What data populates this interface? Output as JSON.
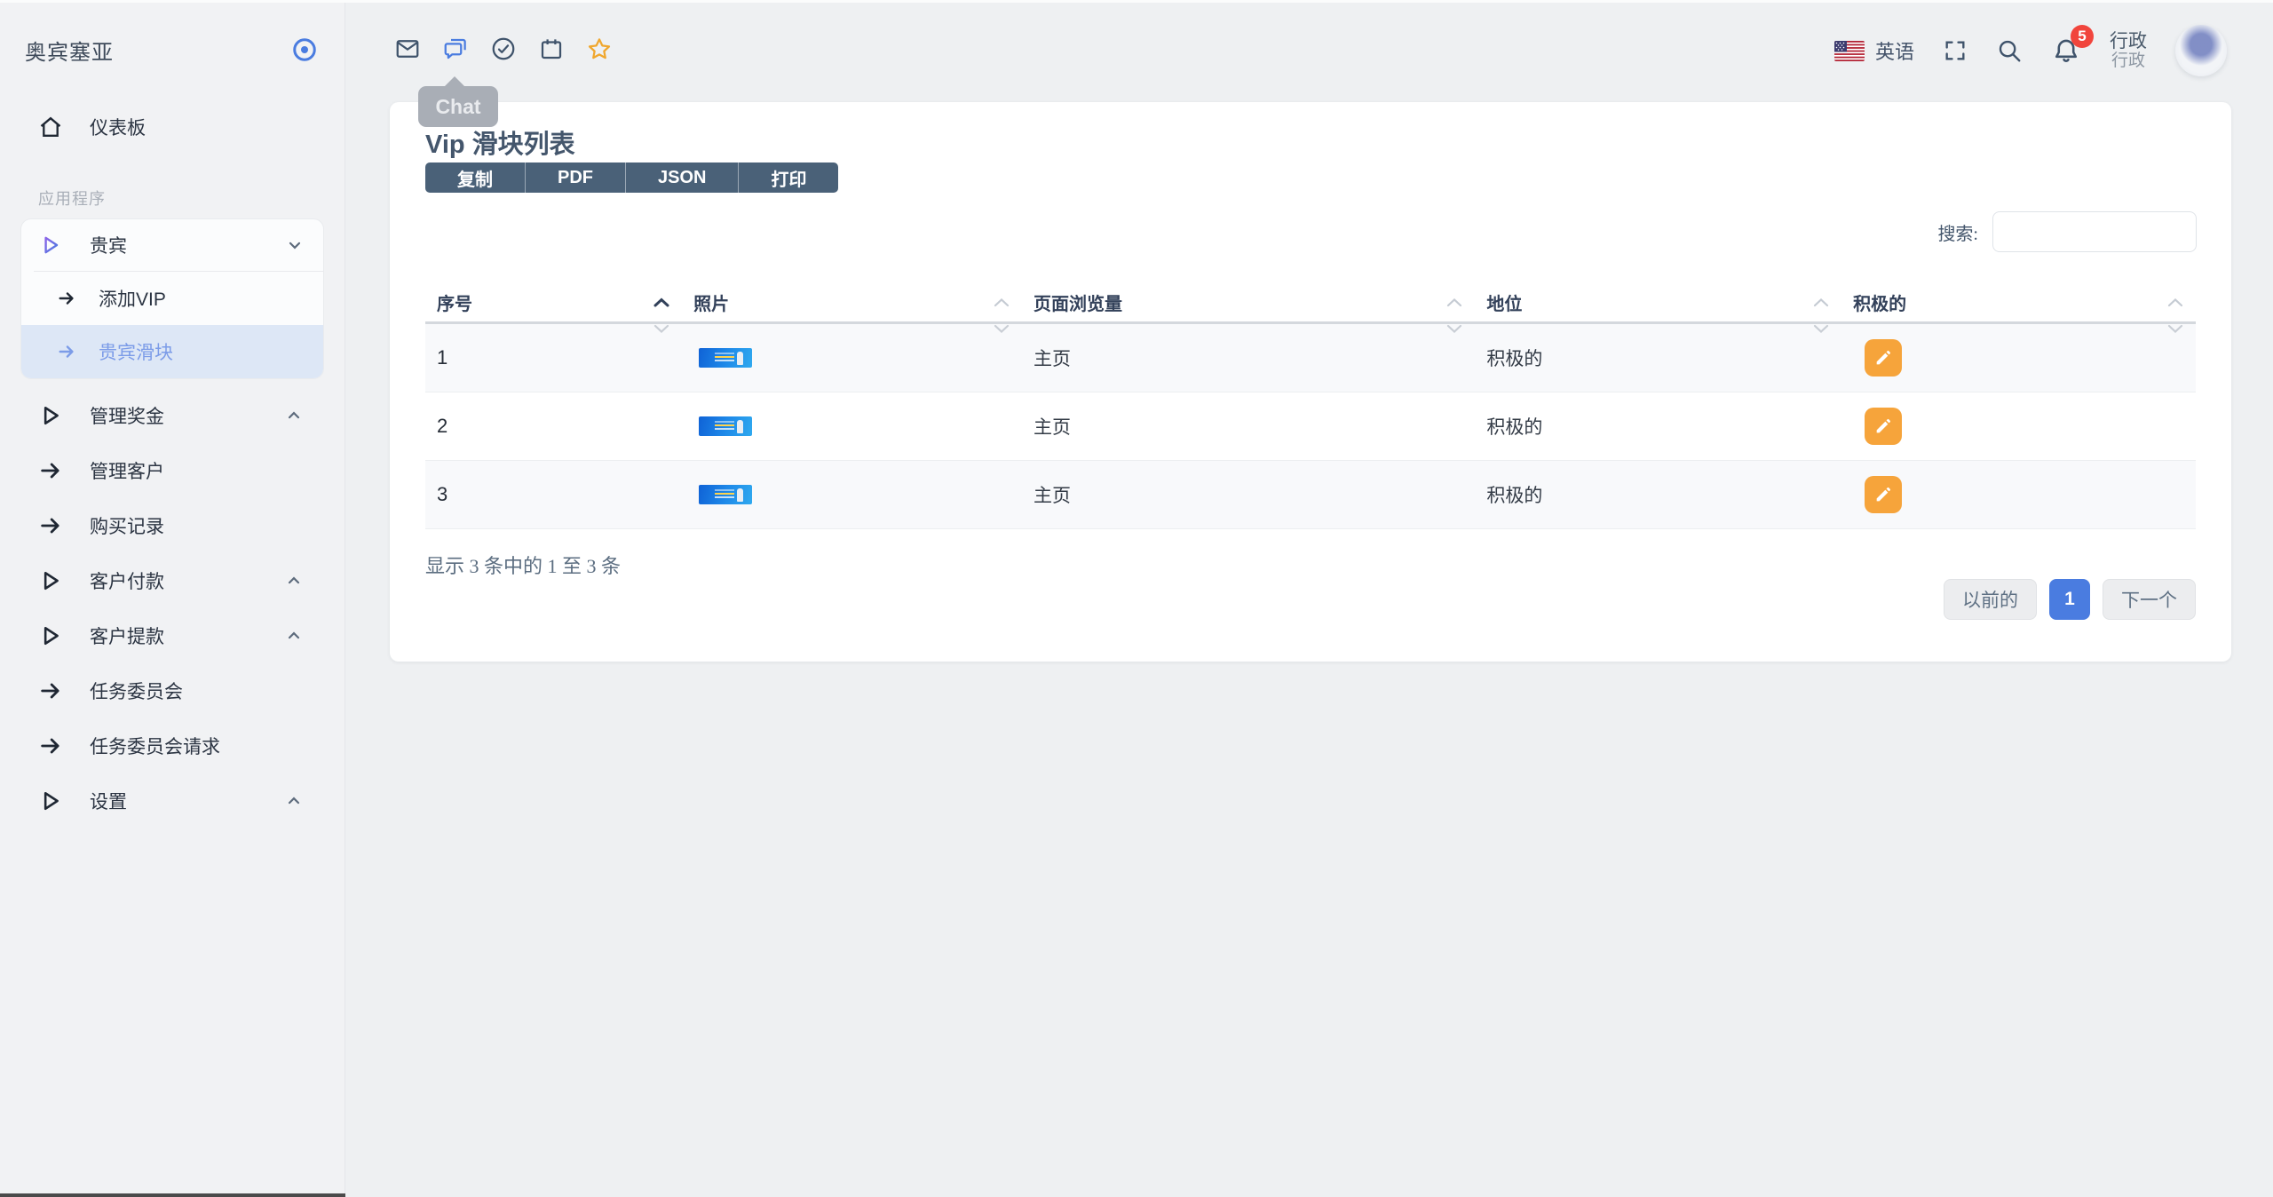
{
  "colors": {
    "accent": "#4a7ce0",
    "orange": "#f6a43b",
    "star_orange": "#f0a72e",
    "danger": "#f1453d",
    "slate": "#44566c",
    "navy": "#3f536b",
    "btn_dark": "#4a6178",
    "active_bg": "#dde7f6",
    "active_text": "#7c9ce8",
    "page_bg": "#eef0f2",
    "sidebar_bg": "#f1f2f4",
    "border": "#e4e6ea"
  },
  "brand": {
    "name": "奥宾塞亚",
    "toggle_icon": "target-icon"
  },
  "sidebar": {
    "dashboard_label": "仪表板",
    "section_label": "应用程序",
    "vip_group": {
      "label": "贵宾",
      "children": [
        {
          "label": "添加VIP",
          "active": false
        },
        {
          "label": "贵宾滑块",
          "active": true
        }
      ]
    },
    "items": [
      {
        "label": "管理奖金",
        "icon": "play",
        "chevron": "up"
      },
      {
        "label": "管理客户",
        "icon": "arrow-right",
        "chevron": null
      },
      {
        "label": "购买记录",
        "icon": "arrow-right",
        "chevron": null
      },
      {
        "label": "客户付款",
        "icon": "play",
        "chevron": "up"
      },
      {
        "label": "客户提款",
        "icon": "play",
        "chevron": "up"
      },
      {
        "label": "任务委员会",
        "icon": "arrow-right",
        "chevron": null
      },
      {
        "label": "任务委员会请求",
        "icon": "arrow-right",
        "chevron": null
      },
      {
        "label": "设置",
        "icon": "play",
        "chevron": "up"
      }
    ]
  },
  "topbar": {
    "left_icons": [
      "mail-icon",
      "chat-icon",
      "check-circle-icon",
      "calendar-icon",
      "star-icon"
    ],
    "tooltip": "Chat",
    "language": "英语",
    "notification_count": "5",
    "user": {
      "name": "行政",
      "role": "行政"
    }
  },
  "page": {
    "title": "Vip 滑块列表",
    "export_buttons": [
      "复制",
      "PDF",
      "JSON",
      "打印"
    ],
    "search_label": "搜索:",
    "table": {
      "columns": [
        "序号",
        "照片",
        "页面浏览量",
        "地位",
        "积极的"
      ],
      "sorted_column": "序号",
      "sort_direction": "asc",
      "rows": [
        {
          "no": "1",
          "page": "主页",
          "status": "积极的"
        },
        {
          "no": "2",
          "page": "主页",
          "status": "积极的"
        },
        {
          "no": "3",
          "page": "主页",
          "status": "积极的"
        }
      ]
    },
    "footer_info": "显示 3 条中的 1 至 3 条",
    "pagination": {
      "prev": "以前的",
      "current": "1",
      "next": "下一个"
    }
  }
}
